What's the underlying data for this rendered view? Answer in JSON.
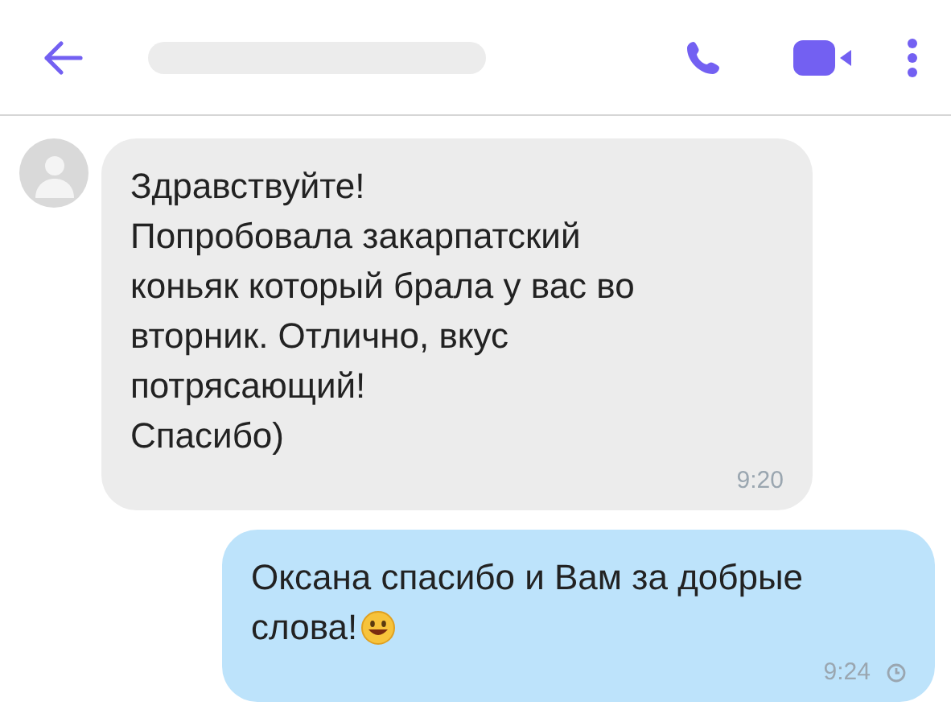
{
  "header": {
    "title_redacted": true
  },
  "messages": [
    {
      "kind": "incoming",
      "lines": [
        "Здравствуйте!",
        "Попробовала закарпатский",
        "коньяк который брала у вас во",
        "вторник. Отлично, вкус",
        "потрясающий!",
        "Спасибо)"
      ],
      "time": "9:20",
      "emoji": false,
      "pending": false
    },
    {
      "kind": "outgoing",
      "lines": [
        "Оксана спасибо и Вам за добрые",
        "слова!"
      ],
      "time": "9:24",
      "emoji": true,
      "pending": true
    }
  ]
}
